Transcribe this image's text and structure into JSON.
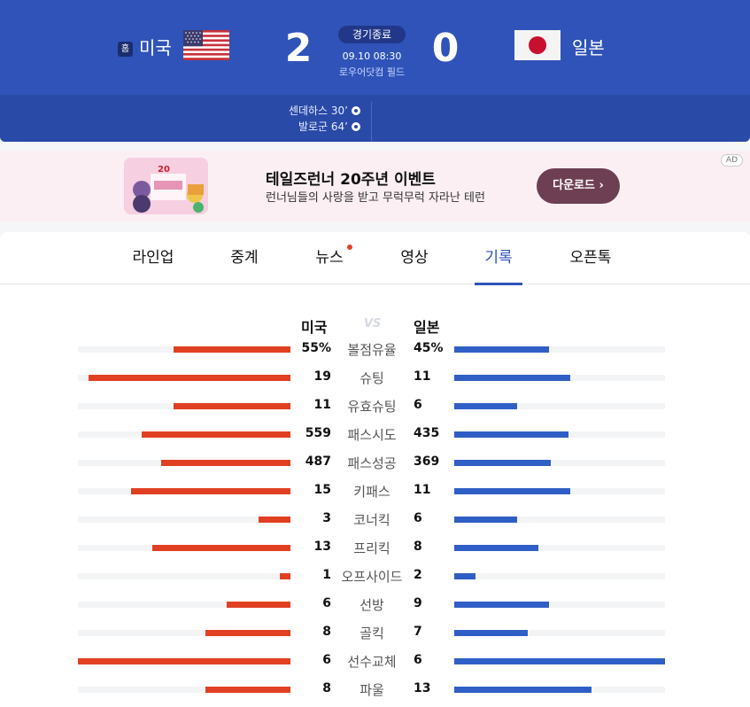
{
  "match": {
    "home_badge": "홈",
    "home_team": "미국",
    "away_team": "일본",
    "home_score": "2",
    "away_score": "0",
    "status": "경기종료",
    "datetime": "09.10 08:30",
    "venue": "로우어닷컴 필드",
    "scorers": [
      "센데하스 30’",
      "발로군 64’"
    ]
  },
  "ad": {
    "label": "AD",
    "title": "테일즈런너 20주년 이벤트",
    "description": "런너님들의 사랑을 받고 무럭무럭 자라난 테런",
    "button": "다운로드 ›"
  },
  "tabs": [
    {
      "label": "라인업",
      "active": false,
      "dot": false
    },
    {
      "label": "중계",
      "active": false,
      "dot": false
    },
    {
      "label": "뉴스",
      "active": false,
      "dot": true
    },
    {
      "label": "영상",
      "active": false,
      "dot": false
    },
    {
      "label": "기록",
      "active": true,
      "dot": false
    },
    {
      "label": "오픈톡",
      "active": false,
      "dot": false
    }
  ],
  "stats": {
    "home_label": "미국",
    "vs_label": "VS",
    "away_label": "일본",
    "rows": [
      {
        "label": "볼점유율",
        "home": "55%",
        "away": "45%",
        "home_ratio": 0.55,
        "away_ratio": 0.45
      },
      {
        "label": "슈팅",
        "home": "19",
        "away": "11",
        "home_ratio": 0.95,
        "away_ratio": 0.55
      },
      {
        "label": "유효슈팅",
        "home": "11",
        "away": "6",
        "home_ratio": 0.55,
        "away_ratio": 0.3
      },
      {
        "label": "패스시도",
        "home": "559",
        "away": "435",
        "home_ratio": 0.7,
        "away_ratio": 0.54
      },
      {
        "label": "패스성공",
        "home": "487",
        "away": "369",
        "home_ratio": 0.61,
        "away_ratio": 0.46
      },
      {
        "label": "키패스",
        "home": "15",
        "away": "11",
        "home_ratio": 0.75,
        "away_ratio": 0.55
      },
      {
        "label": "코너킥",
        "home": "3",
        "away": "6",
        "home_ratio": 0.15,
        "away_ratio": 0.3
      },
      {
        "label": "프리킥",
        "home": "13",
        "away": "8",
        "home_ratio": 0.65,
        "away_ratio": 0.4
      },
      {
        "label": "오프사이드",
        "home": "1",
        "away": "2",
        "home_ratio": 0.05,
        "away_ratio": 0.1
      },
      {
        "label": "선방",
        "home": "6",
        "away": "9",
        "home_ratio": 0.3,
        "away_ratio": 0.45
      },
      {
        "label": "골킥",
        "home": "8",
        "away": "7",
        "home_ratio": 0.4,
        "away_ratio": 0.35
      },
      {
        "label": "선수교체",
        "home": "6",
        "away": "6",
        "home_ratio": 1.0,
        "away_ratio": 1.0
      },
      {
        "label": "파울",
        "home": "8",
        "away": "13",
        "home_ratio": 0.4,
        "away_ratio": 0.65
      }
    ]
  },
  "colors": {
    "header_blue": "#2f53b8",
    "home_bar": "#e13f22",
    "away_bar": "#2f5fc6",
    "active_tab": "#2f53b8"
  },
  "icons": {
    "goal": "soccer-ball-icon",
    "ad_arrow": "chevron-right-icon"
  }
}
